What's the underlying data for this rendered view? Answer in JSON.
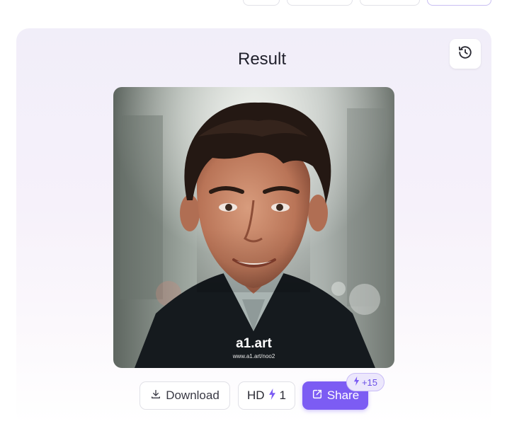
{
  "result": {
    "title": "Result",
    "history_icon": "history-icon",
    "image_alt": "AI generated portrait of a smiling man with dark wavy hair",
    "watermark": {
      "logo": "a1.art",
      "url": "www.a1.art/noo2"
    }
  },
  "actions": {
    "download_label": "Download",
    "download_icon": "download-icon",
    "hd_label": "HD",
    "hd_cost": "1",
    "hd_icon": "lightning-icon",
    "share_label": "Share",
    "share_icon": "share-icon",
    "share_bonus": "+15"
  },
  "colors": {
    "accent": "#7c5cf3",
    "badge_bg": "#ece7fc",
    "text": "#1f1f2b"
  }
}
